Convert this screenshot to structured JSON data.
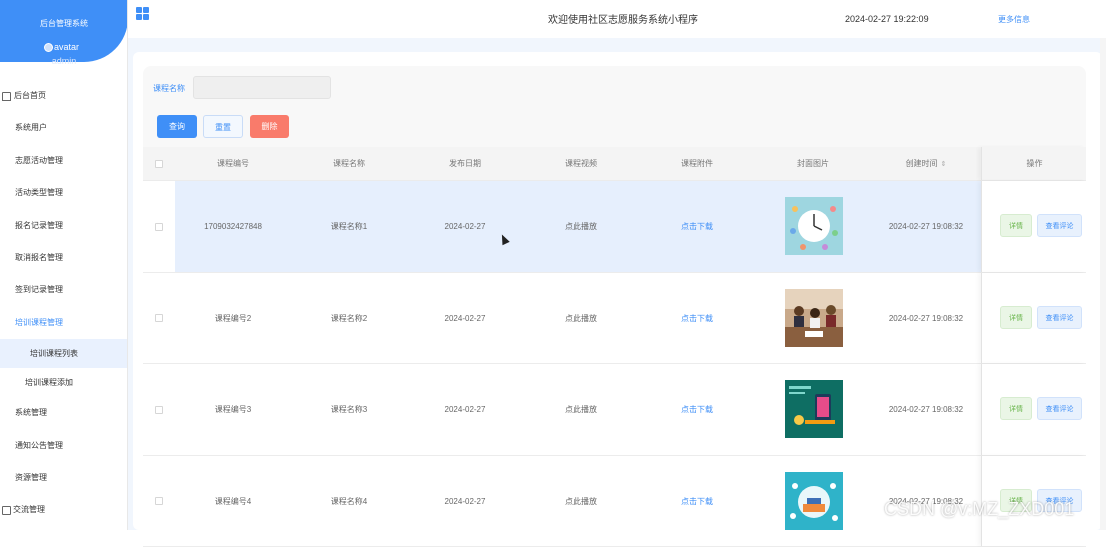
{
  "sidebar": {
    "brand_title": "后台管理系统",
    "avatar_alt": "avatar",
    "username": "admin",
    "menu": [
      {
        "label": "后台首页"
      },
      {
        "label": "系统用户"
      },
      {
        "label": "志愿活动管理"
      },
      {
        "label": "活动类型管理"
      },
      {
        "label": "报名记录管理"
      },
      {
        "label": "取消报名管理"
      },
      {
        "label": "签到记录管理"
      },
      {
        "label": "培训课程管理"
      },
      {
        "label": "培训课程列表"
      },
      {
        "label": "培训课程添加"
      },
      {
        "label": "系统管理"
      },
      {
        "label": "通知公告管理"
      },
      {
        "label": "资源管理"
      },
      {
        "label": "交流管理"
      }
    ]
  },
  "header": {
    "welcome": "欢迎使用社区志愿服务系统小程序",
    "datetime": "2024-02-27 19:22:09",
    "more": "更多信息"
  },
  "search": {
    "label": "课程名称",
    "value": "",
    "query_button": "查询",
    "reset_button": "重置",
    "delete_button": "删除"
  },
  "table": {
    "columns": [
      "课程编号",
      "课程名称",
      "发布日期",
      "课程视频",
      "课程附件",
      "封面图片",
      "创建时间",
      "操作"
    ],
    "rows": [
      {
        "id": "1709032427848",
        "name": "课程名称1",
        "date": "2024-02-27",
        "video": "点此播放",
        "attachment": "点击下载",
        "created": "2024-02-27 19:08:32"
      },
      {
        "id": "课程编号2",
        "name": "课程名称2",
        "date": "2024-02-27",
        "video": "点此播放",
        "attachment": "点击下载",
        "created": "2024-02-27 19:08:32"
      },
      {
        "id": "课程编号3",
        "name": "课程名称3",
        "date": "2024-02-27",
        "video": "点此播放",
        "attachment": "点击下载",
        "created": "2024-02-27 19:08:32"
      },
      {
        "id": "课程编号4",
        "name": "课程名称4",
        "date": "2024-02-27",
        "video": "点此播放",
        "attachment": "点击下载",
        "created": "2024-02-27 19:08:32"
      }
    ],
    "ops": {
      "detail": "详情",
      "review": "查看评论"
    }
  },
  "watermark": "CSDN @v:MZ_ZXD001",
  "colors": {
    "accent": "#3f8ff7",
    "danger": "#f97b6b",
    "success": "#69b54b"
  }
}
